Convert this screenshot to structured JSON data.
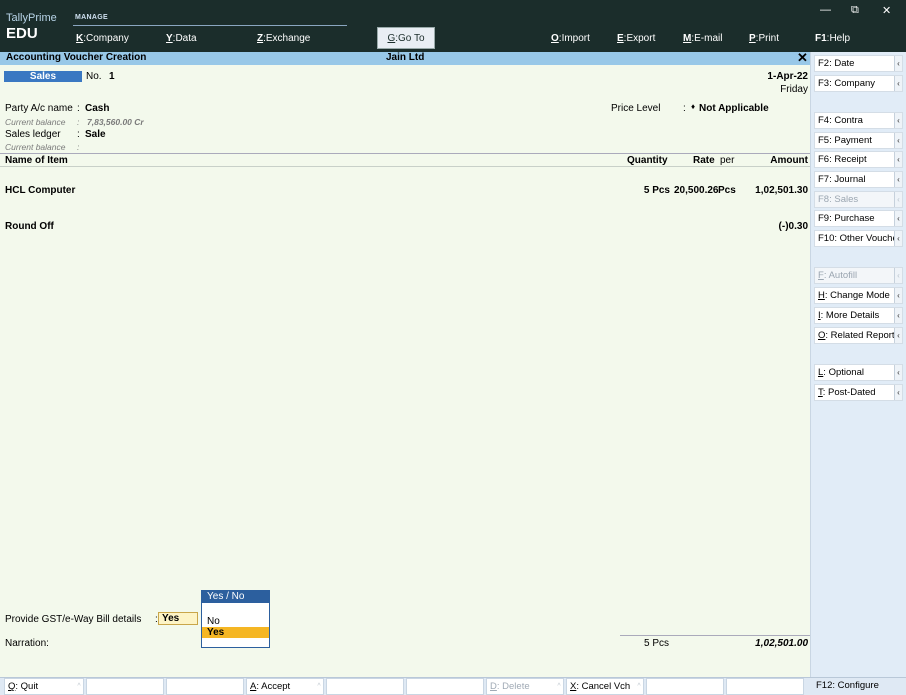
{
  "app": {
    "brand_top": "TallyPrime",
    "brand_bottom": "EDU",
    "section": "MANAGE",
    "window_controls": [
      "—",
      "⧉",
      "✕"
    ]
  },
  "top_menu": [
    {
      "key": "K",
      "label": "Company"
    },
    {
      "key": "Y",
      "label": "Data"
    },
    {
      "key": "Z",
      "label": "Exchange"
    },
    {
      "key": "G",
      "label": "Go To"
    },
    {
      "key": "O",
      "label": "Import"
    },
    {
      "key": "E",
      "label": "Export"
    },
    {
      "key": "M",
      "label": "E-mail"
    },
    {
      "key": "P",
      "label": "Print"
    },
    {
      "key": "F1",
      "label": "Help"
    }
  ],
  "header": {
    "title": "Accounting Voucher Creation",
    "company": "Jain Ltd",
    "close": "✕"
  },
  "voucher": {
    "type": "Sales",
    "no_label": "No.",
    "no": "1",
    "date": "1-Apr-22",
    "day": "Friday",
    "party_label": "Party A/c name",
    "party": "Cash",
    "party_balance_label": "Current balance",
    "party_balance": "7,83,560.00 Cr",
    "ledger_label": "Sales ledger",
    "ledger": "Sale",
    "ledger_balance_label": "Current balance",
    "price_level_label": "Price Level",
    "price_level": "Not Applicable"
  },
  "columns": {
    "name": "Name of Item",
    "quantity": "Quantity",
    "rate": "Rate",
    "per": "per",
    "amount": "Amount"
  },
  "items": [
    {
      "name": "HCL Computer",
      "quantity": "5 Pcs",
      "rate": "20,500.26",
      "per": "Pcs",
      "amount": "1,02,501.30"
    }
  ],
  "round_off": {
    "label": "Round Off",
    "amount": "(-)0.30"
  },
  "gst": {
    "label": "Provide GST/e-Way Bill details",
    "value": "Yes",
    "popup_title": "Yes / No",
    "options": [
      "No",
      "Yes"
    ],
    "selected": "Yes"
  },
  "narration_label": "Narration:",
  "totals": {
    "quantity": "5 Pcs",
    "amount": "1,02,501.00"
  },
  "sidebar": [
    {
      "key": "F2",
      "label": "Date",
      "enabled": true
    },
    {
      "key": "F3",
      "label": "Company",
      "enabled": true
    },
    {
      "key": "F4",
      "label": "Contra",
      "enabled": true
    },
    {
      "key": "F5",
      "label": "Payment",
      "enabled": true
    },
    {
      "key": "F6",
      "label": "Receipt",
      "enabled": true
    },
    {
      "key": "F7",
      "label": "Journal",
      "enabled": true
    },
    {
      "key": "F8",
      "label": "Sales",
      "enabled": false
    },
    {
      "key": "F9",
      "label": "Purchase",
      "enabled": true
    },
    {
      "key": "F10",
      "label": "Other Vouchers",
      "enabled": true
    },
    {
      "key": "F",
      "label": "Autofill",
      "enabled": false
    },
    {
      "key": "H",
      "label": "Change Mode",
      "enabled": true
    },
    {
      "key": "I",
      "label": "More Details",
      "enabled": true
    },
    {
      "key": "O",
      "label": "Related Reports",
      "enabled": true
    },
    {
      "key": "L",
      "label": "Optional",
      "enabled": true
    },
    {
      "key": "T",
      "label": "Post-Dated",
      "enabled": true
    }
  ],
  "bottom_bar": [
    {
      "key": "Q",
      "label": "Quit",
      "enabled": true
    },
    {
      "key": "A",
      "label": "Accept",
      "enabled": true
    },
    {
      "key": "D",
      "label": "Delete",
      "enabled": false
    },
    {
      "key": "X",
      "label": "Cancel Vch",
      "enabled": true
    },
    {
      "key": "F12",
      "label": "Configure",
      "enabled": true
    }
  ],
  "colors": {
    "topbar": "#1b2d2b",
    "header_strip": "#98c8e8",
    "voucher_bg": "#f3f9ec",
    "voucher_type_bg": "#3a78c2",
    "popup_selected": "#f5b623",
    "sidebar_bg": "#e1ecf7"
  }
}
